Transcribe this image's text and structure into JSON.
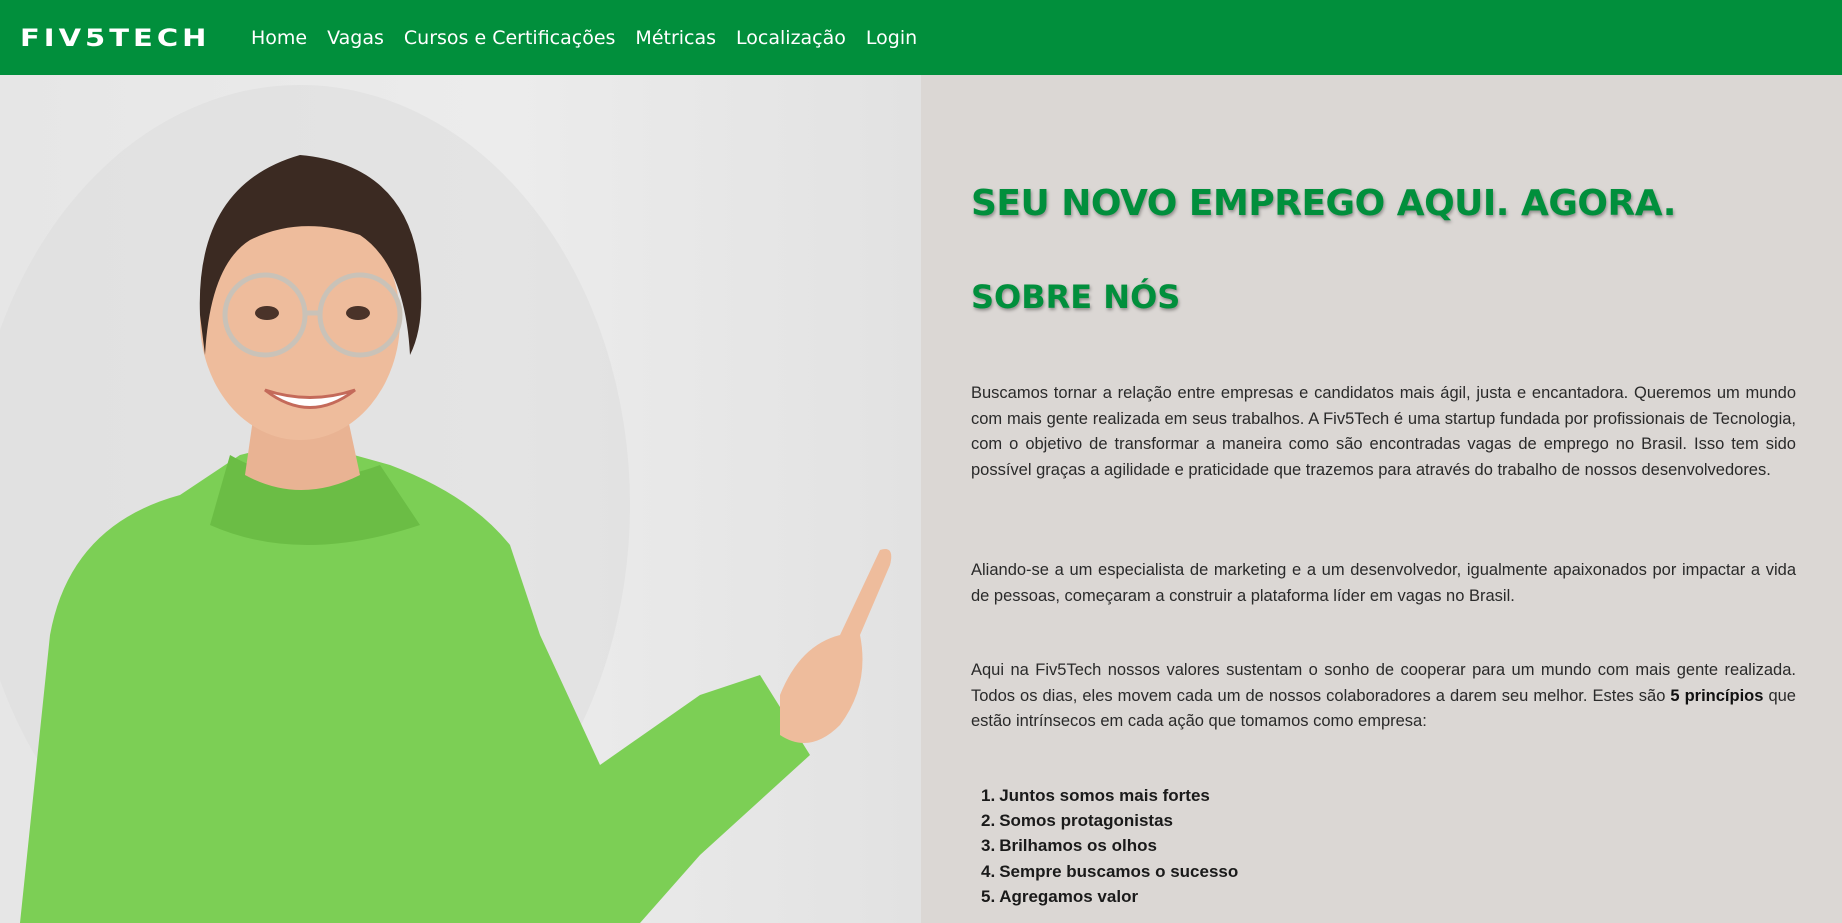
{
  "brand": {
    "logo_text": "FIV5TECH",
    "accent_color": "#018f3c"
  },
  "nav": {
    "items": [
      {
        "label": "Home"
      },
      {
        "label": "Vagas"
      },
      {
        "label": "Cursos e Certificações"
      },
      {
        "label": "Métricas"
      },
      {
        "label": "Localização"
      },
      {
        "label": "Login"
      }
    ]
  },
  "hero": {
    "image_alt": "woman-pointing-photo"
  },
  "main": {
    "headline": "SEU NOVO EMPREGO AQUI. AGORA.",
    "subheading": "SOBRE NÓS",
    "paragraph1": "Buscamos tornar a relação entre empresas e candidatos mais ágil, justa e encantadora. Queremos um mundo com mais gente realizada em seus trabalhos. A Fiv5Tech é uma startup fundada por profissionais de Tecnologia, com o objetivo de transformar a maneira como são encontradas vagas de emprego no Brasil. Isso tem sido possível graças a agilidade e praticidade que trazemos para através do trabalho de nossos desenvolvedores.",
    "paragraph2": "Aliando-se a um especialista de marketing e a um desenvolvedor, igualmente apaixonados por impactar a vida de pessoas, começaram a construir a plataforma líder em vagas no Brasil.",
    "paragraph3_before": "Aqui na Fiv5Tech nossos valores sustentam o sonho de cooperar para um mundo com mais gente realizada. Todos os dias, eles movem cada um de nossos colaboradores a darem seu melhor. Estes são ",
    "paragraph3_bold": "5 princípios",
    "paragraph3_after": " que estão intrínsecos em cada ação que tomamos como empresa:",
    "principles": [
      {
        "num": "1.",
        "text": "Juntos somos mais fortes"
      },
      {
        "num": "2.",
        "text": "Somos protagonistas"
      },
      {
        "num": "3.",
        "text": "Brilhamos os olhos"
      },
      {
        "num": "4.",
        "text": "Sempre buscamos o sucesso"
      },
      {
        "num": "5.",
        "text": "Agregamos valor"
      }
    ]
  }
}
